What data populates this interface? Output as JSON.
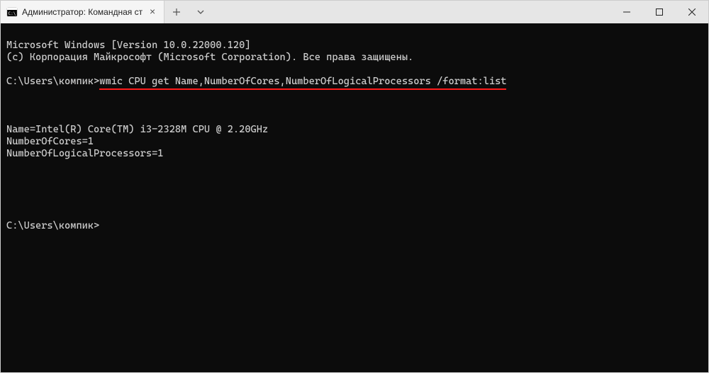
{
  "window": {
    "tab_title": "Администратор: Командная ст"
  },
  "terminal": {
    "line1": "Microsoft Windows [Version 10.0.22000.120]",
    "line2": "(c) Корпорация Майкрософт (Microsoft Corporation). Все права защищены.",
    "prompt1_path": "C:\\Users\\компик>",
    "command1": "wmic CPU get Name,NumberOfCores,NumberOfLogicalProcessors /format:list",
    "output_line1": "Name=Intel(R) Core(TM) i3-2328M CPU @ 2.20GHz",
    "output_line2": "NumberOfCores=1",
    "output_line3": "NumberOfLogicalProcessors=1",
    "prompt2_path": "C:\\Users\\компик>"
  }
}
